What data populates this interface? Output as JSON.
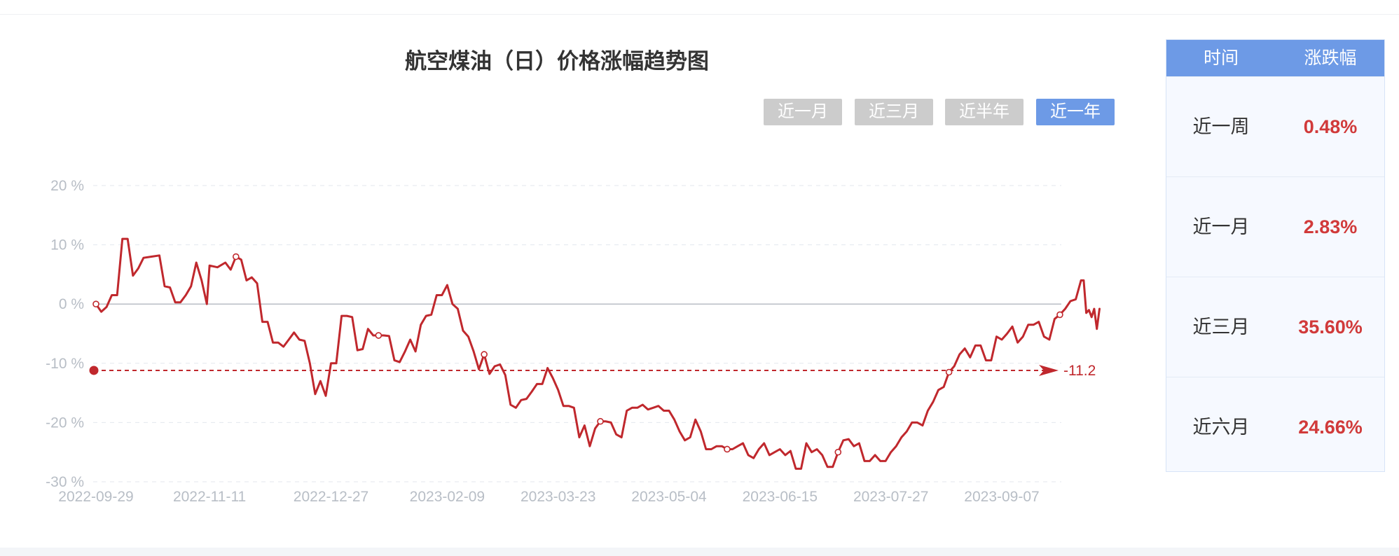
{
  "title": "航空煤油（日）价格涨幅趋势图",
  "range_tabs": [
    {
      "label": "近一月",
      "active": false
    },
    {
      "label": "近三月",
      "active": false
    },
    {
      "label": "近半年",
      "active": false
    },
    {
      "label": "近一年",
      "active": true
    }
  ],
  "colors": {
    "accent": "#6d9ae6",
    "line": "#c0282d",
    "inactive_tab": "#cccccc",
    "positive": "#d13a3a"
  },
  "side_table": {
    "headers": [
      "时间",
      "涨跌幅"
    ],
    "rows": [
      {
        "label": "近一周",
        "value": "0.48%"
      },
      {
        "label": "近一月",
        "value": "2.83%"
      },
      {
        "label": "近三月",
        "value": "35.60%"
      },
      {
        "label": "近六月",
        "value": "24.66%"
      }
    ]
  },
  "chart_data": {
    "type": "line",
    "ylim": [
      -30,
      20
    ],
    "y_ticks": [
      20,
      10,
      0,
      -10,
      -20,
      -30
    ],
    "y_tick_labels": [
      "20 %",
      "10 %",
      "0 %",
      "-10 %",
      "-20 %",
      "-30 %"
    ],
    "x_tick_labels": [
      "2022-09-29",
      "2022-11-11",
      "2022-12-27",
      "2023-02-09",
      "2023-03-23",
      "2023-05-04",
      "2023-06-15",
      "2023-07-27",
      "2023-09-07"
    ],
    "grid": "horizontal dashed",
    "reference_line": {
      "value": -11.2,
      "label": "-11.2",
      "style": "dashed-arrow"
    },
    "series": [
      {
        "points": [
          [
            "2022-09-29",
            0.0
          ],
          [
            "2022-10-01",
            -1.3
          ],
          [
            "2022-10-03",
            -0.5
          ],
          [
            "2022-10-05",
            1.5
          ],
          [
            "2022-10-07",
            1.5
          ],
          [
            "2022-10-09",
            11.0
          ],
          [
            "2022-10-11",
            11.0
          ],
          [
            "2022-10-13",
            4.8
          ],
          [
            "2022-10-15",
            6.0
          ],
          [
            "2022-10-17",
            7.8
          ],
          [
            "2022-10-20",
            8.0
          ],
          [
            "2022-10-23",
            8.2
          ],
          [
            "2022-10-25",
            3.0
          ],
          [
            "2022-10-27",
            2.8
          ],
          [
            "2022-10-29",
            0.3
          ],
          [
            "2022-10-31",
            0.3
          ],
          [
            "2022-11-02",
            1.5
          ],
          [
            "2022-11-04",
            3.0
          ],
          [
            "2022-11-06",
            7.0
          ],
          [
            "2022-11-08",
            4.0
          ],
          [
            "2022-11-10",
            0.0
          ],
          [
            "2022-11-11",
            6.5
          ],
          [
            "2022-11-14",
            6.2
          ],
          [
            "2022-11-17",
            7.0
          ],
          [
            "2022-11-19",
            5.8
          ],
          [
            "2022-11-21",
            8.0
          ],
          [
            "2022-11-23",
            7.5
          ],
          [
            "2022-11-25",
            4.0
          ],
          [
            "2022-11-27",
            4.5
          ],
          [
            "2022-11-29",
            3.5
          ],
          [
            "2022-12-01",
            -3.0
          ],
          [
            "2022-12-03",
            -3.0
          ],
          [
            "2022-12-05",
            -6.5
          ],
          [
            "2022-12-07",
            -6.5
          ],
          [
            "2022-12-09",
            -7.2
          ],
          [
            "2022-12-11",
            -6.0
          ],
          [
            "2022-12-13",
            -4.8
          ],
          [
            "2022-12-15",
            -6.0
          ],
          [
            "2022-12-17",
            -6.2
          ],
          [
            "2022-12-19",
            -10.0
          ],
          [
            "2022-12-21",
            -15.2
          ],
          [
            "2022-12-23",
            -13.0
          ],
          [
            "2022-12-25",
            -15.5
          ],
          [
            "2022-12-27",
            -10.0
          ],
          [
            "2022-12-29",
            -10.0
          ],
          [
            "2022-12-31",
            -2.0
          ],
          [
            "2023-01-02",
            -2.0
          ],
          [
            "2023-01-04",
            -2.2
          ],
          [
            "2023-01-06",
            -7.8
          ],
          [
            "2023-01-08",
            -7.6
          ],
          [
            "2023-01-10",
            -4.2
          ],
          [
            "2023-01-12",
            -5.3
          ],
          [
            "2023-01-14",
            -5.3
          ],
          [
            "2023-01-16",
            -5.3
          ],
          [
            "2023-01-18",
            -5.4
          ],
          [
            "2023-01-20",
            -9.5
          ],
          [
            "2023-01-22",
            -9.8
          ],
          [
            "2023-01-24",
            -8.0
          ],
          [
            "2023-01-26",
            -6.0
          ],
          [
            "2023-01-28",
            -8.0
          ],
          [
            "2023-01-30",
            -3.5
          ],
          [
            "2023-02-01",
            -2.0
          ],
          [
            "2023-02-03",
            -1.8
          ],
          [
            "2023-02-05",
            1.5
          ],
          [
            "2023-02-07",
            1.5
          ],
          [
            "2023-02-09",
            3.2
          ],
          [
            "2023-02-11",
            0.0
          ],
          [
            "2023-02-13",
            -0.8
          ],
          [
            "2023-02-15",
            -4.5
          ],
          [
            "2023-02-17",
            -5.5
          ],
          [
            "2023-02-19",
            -8.0
          ],
          [
            "2023-02-21",
            -11.0
          ],
          [
            "2023-02-23",
            -8.5
          ],
          [
            "2023-02-25",
            -11.8
          ],
          [
            "2023-02-27",
            -10.5
          ],
          [
            "2023-03-01",
            -10.2
          ],
          [
            "2023-03-03",
            -12.0
          ],
          [
            "2023-03-05",
            -17.0
          ],
          [
            "2023-03-07",
            -17.5
          ],
          [
            "2023-03-09",
            -16.2
          ],
          [
            "2023-03-11",
            -16.0
          ],
          [
            "2023-03-13",
            -14.8
          ],
          [
            "2023-03-15",
            -13.5
          ],
          [
            "2023-03-17",
            -13.5
          ],
          [
            "2023-03-19",
            -10.8
          ],
          [
            "2023-03-21",
            -12.5
          ],
          [
            "2023-03-23",
            -14.5
          ],
          [
            "2023-03-25",
            -17.2
          ],
          [
            "2023-03-27",
            -17.2
          ],
          [
            "2023-03-29",
            -17.5
          ],
          [
            "2023-03-31",
            -22.5
          ],
          [
            "2023-04-02",
            -20.5
          ],
          [
            "2023-04-04",
            -24.0
          ],
          [
            "2023-04-06",
            -21.0
          ],
          [
            "2023-04-08",
            -19.8
          ],
          [
            "2023-04-10",
            -19.8
          ],
          [
            "2023-04-12",
            -20.0
          ],
          [
            "2023-04-14",
            -22.0
          ],
          [
            "2023-04-16",
            -22.5
          ],
          [
            "2023-04-18",
            -18.0
          ],
          [
            "2023-04-20",
            -17.5
          ],
          [
            "2023-04-22",
            -17.5
          ],
          [
            "2023-04-24",
            -17.0
          ],
          [
            "2023-04-26",
            -17.8
          ],
          [
            "2023-04-28",
            -17.5
          ],
          [
            "2023-04-30",
            -17.2
          ],
          [
            "2023-05-02",
            -18.0
          ],
          [
            "2023-05-04",
            -18.0
          ],
          [
            "2023-05-06",
            -19.5
          ],
          [
            "2023-05-08",
            -21.5
          ],
          [
            "2023-05-10",
            -23.0
          ],
          [
            "2023-05-12",
            -22.5
          ],
          [
            "2023-05-14",
            -19.5
          ],
          [
            "2023-05-16",
            -21.5
          ],
          [
            "2023-05-18",
            -24.5
          ],
          [
            "2023-05-20",
            -24.5
          ],
          [
            "2023-05-22",
            -24.0
          ],
          [
            "2023-05-24",
            -24.0
          ],
          [
            "2023-05-26",
            -24.5
          ],
          [
            "2023-05-28",
            -24.5
          ],
          [
            "2023-05-30",
            -24.0
          ],
          [
            "2023-06-01",
            -23.5
          ],
          [
            "2023-06-03",
            -25.5
          ],
          [
            "2023-06-05",
            -26.0
          ],
          [
            "2023-06-07",
            -24.5
          ],
          [
            "2023-06-09",
            -23.5
          ],
          [
            "2023-06-11",
            -25.5
          ],
          [
            "2023-06-13",
            -25.0
          ],
          [
            "2023-06-15",
            -24.5
          ],
          [
            "2023-06-17",
            -25.5
          ],
          [
            "2023-06-19",
            -24.8
          ],
          [
            "2023-06-21",
            -27.8
          ],
          [
            "2023-06-23",
            -27.8
          ],
          [
            "2023-06-25",
            -23.5
          ],
          [
            "2023-06-27",
            -25.0
          ],
          [
            "2023-06-29",
            -24.5
          ],
          [
            "2023-07-01",
            -25.5
          ],
          [
            "2023-07-03",
            -27.5
          ],
          [
            "2023-07-05",
            -27.5
          ],
          [
            "2023-07-07",
            -25.0
          ],
          [
            "2023-07-09",
            -23.0
          ],
          [
            "2023-07-11",
            -22.8
          ],
          [
            "2023-07-13",
            -24.0
          ],
          [
            "2023-07-15",
            -23.5
          ],
          [
            "2023-07-17",
            -26.5
          ],
          [
            "2023-07-19",
            -26.5
          ],
          [
            "2023-07-21",
            -25.5
          ],
          [
            "2023-07-23",
            -26.5
          ],
          [
            "2023-07-25",
            -26.5
          ],
          [
            "2023-07-27",
            -25.0
          ],
          [
            "2023-07-29",
            -24.0
          ],
          [
            "2023-07-31",
            -22.5
          ],
          [
            "2023-08-02",
            -21.5
          ],
          [
            "2023-08-04",
            -20.0
          ],
          [
            "2023-08-06",
            -20.0
          ],
          [
            "2023-08-08",
            -20.5
          ],
          [
            "2023-08-10",
            -18.0
          ],
          [
            "2023-08-12",
            -16.5
          ],
          [
            "2023-08-14",
            -14.5
          ],
          [
            "2023-08-16",
            -14.0
          ],
          [
            "2023-08-18",
            -11.5
          ],
          [
            "2023-08-20",
            -10.5
          ],
          [
            "2023-08-22",
            -8.5
          ],
          [
            "2023-08-24",
            -7.5
          ],
          [
            "2023-08-26",
            -9.0
          ],
          [
            "2023-08-28",
            -7.0
          ],
          [
            "2023-08-30",
            -7.0
          ],
          [
            "2023-09-01",
            -9.5
          ],
          [
            "2023-09-03",
            -9.5
          ],
          [
            "2023-09-05",
            -5.5
          ],
          [
            "2023-09-07",
            -6.0
          ],
          [
            "2023-09-09",
            -5.0
          ],
          [
            "2023-09-11",
            -3.8
          ],
          [
            "2023-09-13",
            -6.5
          ],
          [
            "2023-09-15",
            -5.5
          ],
          [
            "2023-09-17",
            -3.5
          ],
          [
            "2023-09-19",
            -3.5
          ],
          [
            "2023-09-21",
            -3.0
          ],
          [
            "2023-09-23",
            -5.5
          ],
          [
            "2023-09-25",
            -6.0
          ],
          [
            "2023-09-27",
            -2.5
          ],
          [
            "2023-09-29",
            -1.8
          ],
          [
            "2023-10-01",
            -0.8
          ],
          [
            "2023-10-03",
            0.5
          ],
          [
            "2023-10-05",
            0.8
          ],
          [
            "2023-10-07",
            4.0
          ],
          [
            "2023-10-08",
            4.0
          ],
          [
            "2023-10-09",
            -1.5
          ],
          [
            "2023-10-10",
            -1.0
          ],
          [
            "2023-10-11",
            -2.2
          ],
          [
            "2023-10-12",
            -0.8
          ],
          [
            "2023-10-13",
            -4.2
          ],
          [
            "2023-10-14",
            -0.8
          ]
        ]
      }
    ],
    "hollow_markers": [
      "2022-09-29",
      "2022-11-21",
      "2023-01-14",
      "2023-02-23",
      "2023-04-08",
      "2023-05-26",
      "2023-07-07",
      "2023-08-18",
      "2023-09-29"
    ]
  }
}
